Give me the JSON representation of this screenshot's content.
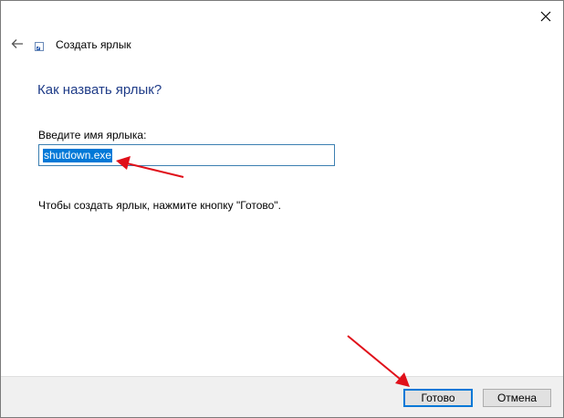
{
  "wizard": {
    "title": "Создать ярлык",
    "heading": "Как назвать ярлык?",
    "field_label": "Введите имя ярлыка:",
    "field_value": "shutdown.exe",
    "hint": "Чтобы создать ярлык, нажмите кнопку \"Готово\"."
  },
  "buttons": {
    "finish_label": "Готово",
    "cancel_label": "Отмена"
  },
  "icons": {
    "close": "close-icon",
    "back": "back-arrow-icon",
    "wizard": "shortcut-icon",
    "annotation": "red-arrow-icon"
  },
  "colors": {
    "heading": "#1f3c88",
    "selection": "#0078d7",
    "primary_border": "#0078d7",
    "annotation_arrow": "#e0101a",
    "footer_bg": "#f0f0f0"
  }
}
